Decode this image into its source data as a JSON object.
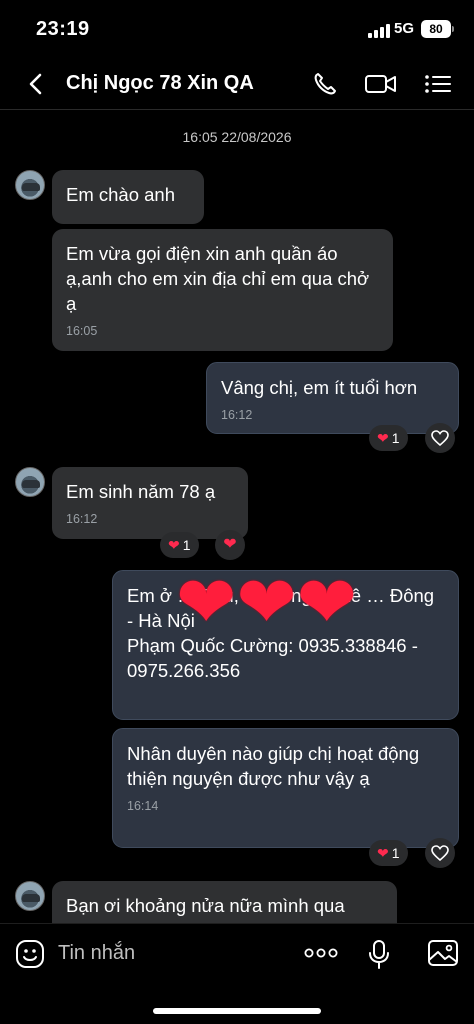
{
  "status_bar": {
    "time": "23:19",
    "network": "5G",
    "battery": "80"
  },
  "header": {
    "title": "Chị Ngọc 78 Xin QA",
    "back_icon": "chevron-left-icon",
    "call_icon": "phone-icon",
    "video_icon": "video-camera-icon",
    "menu_icon": "list-menu-icon"
  },
  "chat": {
    "timestamp": "16:05 22/08/2026",
    "messages": [
      {
        "text": "Em chào anh",
        "direction": "in"
      },
      {
        "text": "Em vừa gọi điện xin anh quần áo ạ,anh cho em xin địa chỉ em qua chở ạ",
        "time": "16:05",
        "direction": "in"
      },
      {
        "text": "Vâng chị, em ít tuổi hơn",
        "time": "16:12",
        "direction": "out",
        "reaction_count": "1"
      },
      {
        "text": "Em sinh năm 78 ạ",
        "time": "16:12",
        "direction": "in",
        "reaction_count": "1"
      },
      {
        "text": "Em ở … Phú, Phường … Lê … Đông - Hà Nội\nPhạm Quốc Cường: 0935.338846 - 0975.266.356",
        "direction": "out"
      },
      {
        "text": "Nhân duyên nào giúp chị hoạt động thiện nguyện được như vậy ạ",
        "time": "16:14",
        "direction": "out",
        "reaction_count": "1"
      },
      {
        "text": "Bạn ơi khoảng nửa nữa mình qua",
        "direction": "in"
      }
    ],
    "sticker": "❤❤❤"
  },
  "input_bar": {
    "placeholder": "Tin nhắn",
    "emoji_icon": "emoji-icon",
    "more_icon": "more-dots-icon",
    "mic_icon": "microphone-icon",
    "image_icon": "image-icon"
  },
  "colors": {
    "background": "#000000",
    "incoming_bubble": "#2f3032",
    "outgoing_bubble": "#2e3542",
    "heart": "#ff2a4f"
  }
}
